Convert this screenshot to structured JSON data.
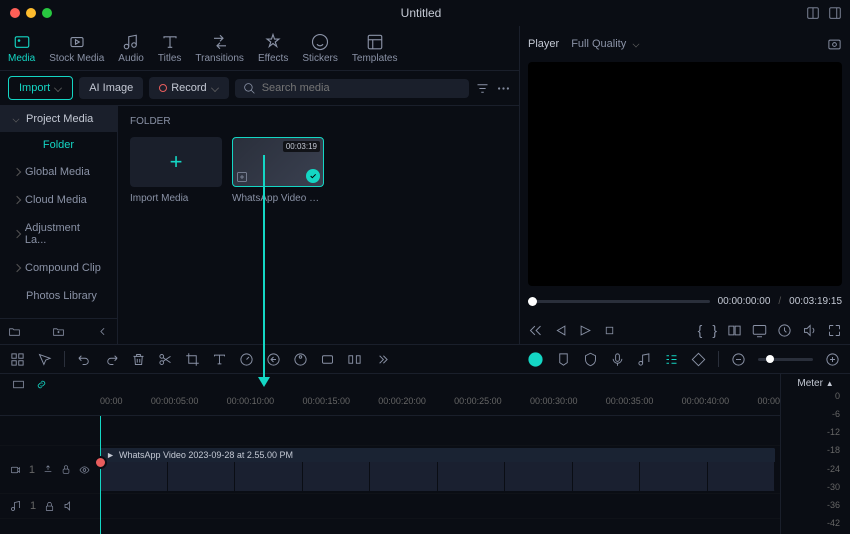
{
  "title": "Untitled",
  "tabs": [
    "Media",
    "Stock Media",
    "Audio",
    "Titles",
    "Transitions",
    "Effects",
    "Stickers",
    "Templates"
  ],
  "toolbar": {
    "import": "Import",
    "aiimage": "AI Image",
    "record": "Record",
    "search_ph": "Search media"
  },
  "sidebar": {
    "header": "Project Media",
    "folder": "Folder",
    "items": [
      "Global Media",
      "Cloud Media",
      "Adjustment La...",
      "Compound Clip",
      "Photos Library"
    ]
  },
  "media": {
    "section": "FOLDER",
    "import_label": "Import Media",
    "clip_name": "WhatsApp Video 202...",
    "clip_duration": "00:03:19"
  },
  "player": {
    "label": "Player",
    "quality": "Full Quality",
    "current": "00:00:00:00",
    "sep": "/",
    "total": "00:03:19:15"
  },
  "ruler": [
    "00:00",
    "00:00:05:00",
    "00:00:10:00",
    "00:00:15:00",
    "00:00:20:00",
    "00:00:25:00",
    "00:00:30:00",
    "00:00:35:00",
    "00:00:40:00",
    "00:00"
  ],
  "meter": {
    "label": "Meter",
    "ticks": [
      "0",
      "-6",
      "-12",
      "-18",
      "-24",
      "-30",
      "-36",
      "-42"
    ]
  },
  "timeline": {
    "clip_title": "WhatsApp Video 2023-09-28 at 2.55.00 PM",
    "video_track": "1",
    "audio_track": "1"
  }
}
